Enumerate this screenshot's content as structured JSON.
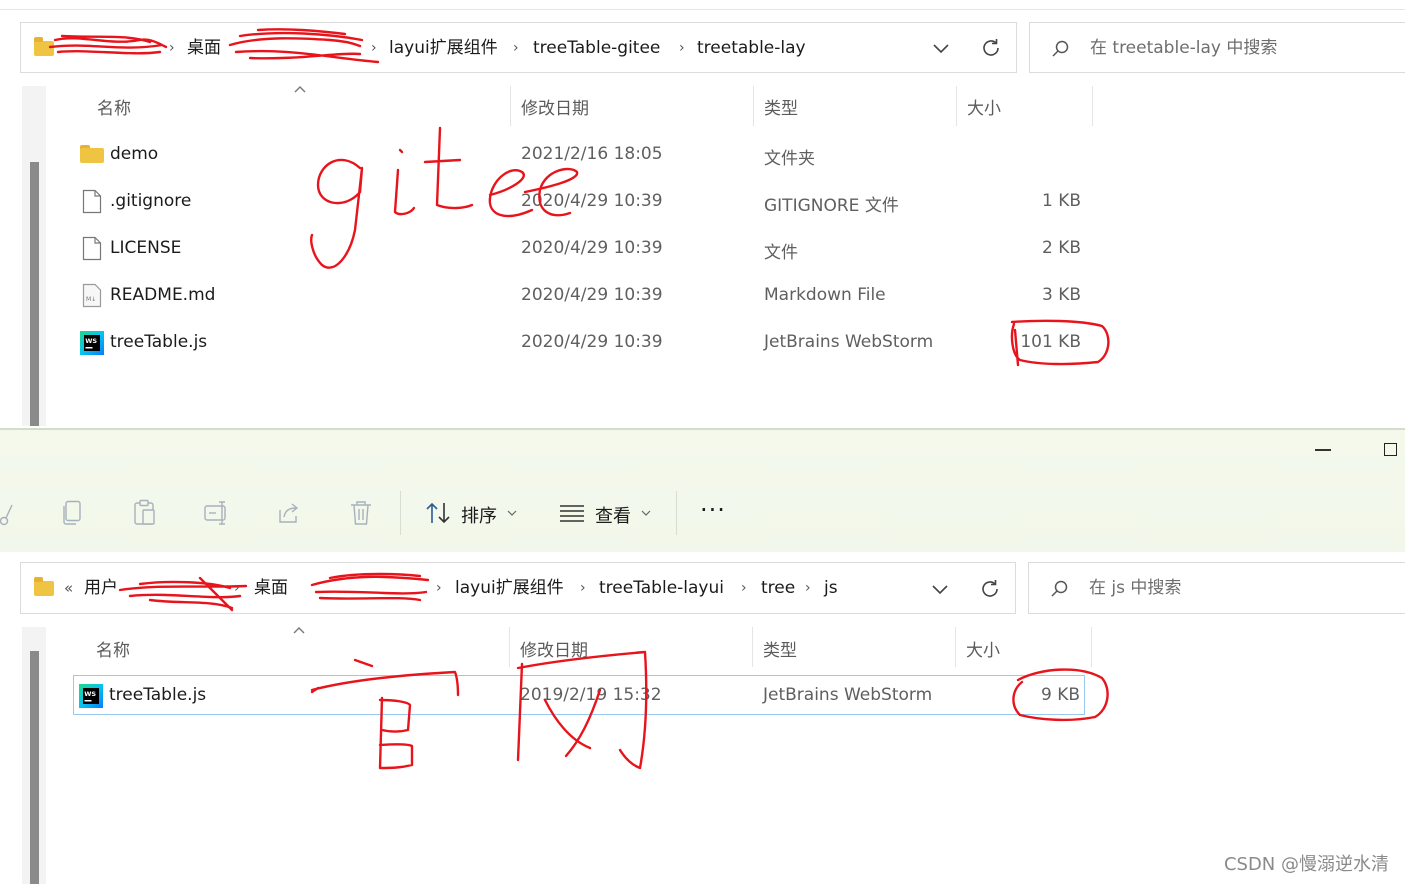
{
  "top": {
    "breadcrumb": {
      "items": [
        "桌面",
        "layui扩展组件",
        "treeTable-gitee",
        "treetable-lay"
      ]
    },
    "search_placeholder": "在 treetable-lay 中搜索",
    "columns": {
      "name": "名称",
      "date": "修改日期",
      "type": "类型",
      "size": "大小"
    },
    "files": [
      {
        "name": "demo",
        "date": "2021/2/16 18:05",
        "type": "文件夹",
        "size": "",
        "icon": "folder-icon"
      },
      {
        "name": ".gitignore",
        "date": "2020/4/29 10:39",
        "type": "GITIGNORE 文件",
        "size": "1 KB",
        "icon": "file-icon"
      },
      {
        "name": "LICENSE",
        "date": "2020/4/29 10:39",
        "type": "文件",
        "size": "2 KB",
        "icon": "file-icon"
      },
      {
        "name": "README.md",
        "date": "2020/4/29 10:39",
        "type": "Markdown File",
        "size": "3 KB",
        "icon": "markdown-file-icon"
      },
      {
        "name": "treeTable.js",
        "date": "2020/4/29 10:39",
        "type": "JetBrains WebStorm",
        "size": "101 KB",
        "icon": "webstorm-icon"
      }
    ]
  },
  "bottom": {
    "toolbar": {
      "sort_label": "排序",
      "view_label": "查看",
      "more_label": "···"
    },
    "breadcrumb": {
      "overflow": "«",
      "items": [
        "用户",
        "桌面",
        "layui扩展组件",
        "treeTable-layui",
        "tree",
        "js"
      ]
    },
    "search_placeholder": "在 js 中搜索",
    "columns": {
      "name": "名称",
      "date": "修改日期",
      "type": "类型",
      "size": "大小"
    },
    "files": [
      {
        "name": "treeTable.js",
        "date": "2019/2/19 15:32",
        "type": "JetBrains WebStorm",
        "size": "9 KB",
        "icon": "webstorm-icon"
      }
    ]
  },
  "watermark": "CSDN @慢溺逆水清",
  "colors": {
    "annotation": "#e8141c",
    "folder": "#f0c443",
    "selection_border": "#99c9ef",
    "toolbar_bg": "#f3f8ec"
  }
}
